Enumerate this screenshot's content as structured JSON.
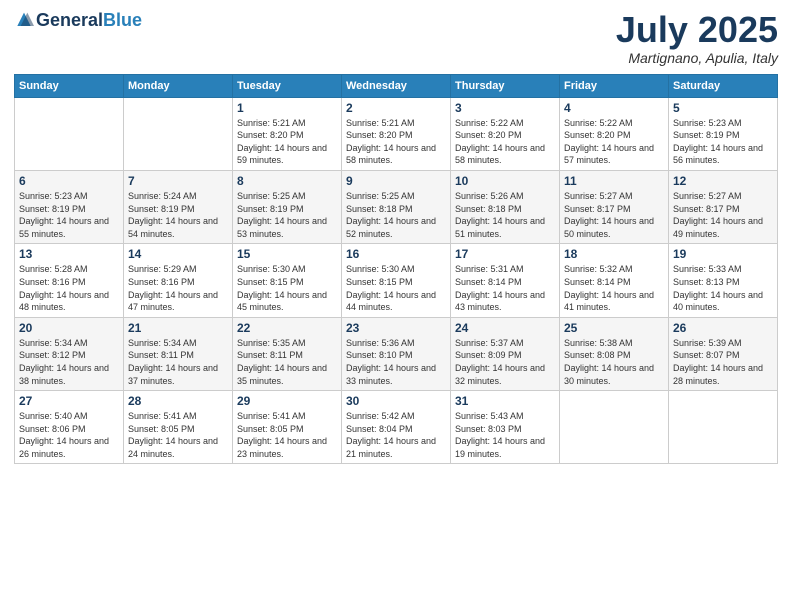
{
  "header": {
    "logo": {
      "text_general": "General",
      "text_blue": "Blue"
    },
    "month_title": "July 2025",
    "location": "Martignano, Apulia, Italy"
  },
  "weekdays": [
    "Sunday",
    "Monday",
    "Tuesday",
    "Wednesday",
    "Thursday",
    "Friday",
    "Saturday"
  ],
  "weeks": [
    [
      {
        "day": "",
        "sunrise": "",
        "sunset": "",
        "daylight": ""
      },
      {
        "day": "",
        "sunrise": "",
        "sunset": "",
        "daylight": ""
      },
      {
        "day": "1",
        "sunrise": "Sunrise: 5:21 AM",
        "sunset": "Sunset: 8:20 PM",
        "daylight": "Daylight: 14 hours and 59 minutes."
      },
      {
        "day": "2",
        "sunrise": "Sunrise: 5:21 AM",
        "sunset": "Sunset: 8:20 PM",
        "daylight": "Daylight: 14 hours and 58 minutes."
      },
      {
        "day": "3",
        "sunrise": "Sunrise: 5:22 AM",
        "sunset": "Sunset: 8:20 PM",
        "daylight": "Daylight: 14 hours and 58 minutes."
      },
      {
        "day": "4",
        "sunrise": "Sunrise: 5:22 AM",
        "sunset": "Sunset: 8:20 PM",
        "daylight": "Daylight: 14 hours and 57 minutes."
      },
      {
        "day": "5",
        "sunrise": "Sunrise: 5:23 AM",
        "sunset": "Sunset: 8:19 PM",
        "daylight": "Daylight: 14 hours and 56 minutes."
      }
    ],
    [
      {
        "day": "6",
        "sunrise": "Sunrise: 5:23 AM",
        "sunset": "Sunset: 8:19 PM",
        "daylight": "Daylight: 14 hours and 55 minutes."
      },
      {
        "day": "7",
        "sunrise": "Sunrise: 5:24 AM",
        "sunset": "Sunset: 8:19 PM",
        "daylight": "Daylight: 14 hours and 54 minutes."
      },
      {
        "day": "8",
        "sunrise": "Sunrise: 5:25 AM",
        "sunset": "Sunset: 8:19 PM",
        "daylight": "Daylight: 14 hours and 53 minutes."
      },
      {
        "day": "9",
        "sunrise": "Sunrise: 5:25 AM",
        "sunset": "Sunset: 8:18 PM",
        "daylight": "Daylight: 14 hours and 52 minutes."
      },
      {
        "day": "10",
        "sunrise": "Sunrise: 5:26 AM",
        "sunset": "Sunset: 8:18 PM",
        "daylight": "Daylight: 14 hours and 51 minutes."
      },
      {
        "day": "11",
        "sunrise": "Sunrise: 5:27 AM",
        "sunset": "Sunset: 8:17 PM",
        "daylight": "Daylight: 14 hours and 50 minutes."
      },
      {
        "day": "12",
        "sunrise": "Sunrise: 5:27 AM",
        "sunset": "Sunset: 8:17 PM",
        "daylight": "Daylight: 14 hours and 49 minutes."
      }
    ],
    [
      {
        "day": "13",
        "sunrise": "Sunrise: 5:28 AM",
        "sunset": "Sunset: 8:16 PM",
        "daylight": "Daylight: 14 hours and 48 minutes."
      },
      {
        "day": "14",
        "sunrise": "Sunrise: 5:29 AM",
        "sunset": "Sunset: 8:16 PM",
        "daylight": "Daylight: 14 hours and 47 minutes."
      },
      {
        "day": "15",
        "sunrise": "Sunrise: 5:30 AM",
        "sunset": "Sunset: 8:15 PM",
        "daylight": "Daylight: 14 hours and 45 minutes."
      },
      {
        "day": "16",
        "sunrise": "Sunrise: 5:30 AM",
        "sunset": "Sunset: 8:15 PM",
        "daylight": "Daylight: 14 hours and 44 minutes."
      },
      {
        "day": "17",
        "sunrise": "Sunrise: 5:31 AM",
        "sunset": "Sunset: 8:14 PM",
        "daylight": "Daylight: 14 hours and 43 minutes."
      },
      {
        "day": "18",
        "sunrise": "Sunrise: 5:32 AM",
        "sunset": "Sunset: 8:14 PM",
        "daylight": "Daylight: 14 hours and 41 minutes."
      },
      {
        "day": "19",
        "sunrise": "Sunrise: 5:33 AM",
        "sunset": "Sunset: 8:13 PM",
        "daylight": "Daylight: 14 hours and 40 minutes."
      }
    ],
    [
      {
        "day": "20",
        "sunrise": "Sunrise: 5:34 AM",
        "sunset": "Sunset: 8:12 PM",
        "daylight": "Daylight: 14 hours and 38 minutes."
      },
      {
        "day": "21",
        "sunrise": "Sunrise: 5:34 AM",
        "sunset": "Sunset: 8:11 PM",
        "daylight": "Daylight: 14 hours and 37 minutes."
      },
      {
        "day": "22",
        "sunrise": "Sunrise: 5:35 AM",
        "sunset": "Sunset: 8:11 PM",
        "daylight": "Daylight: 14 hours and 35 minutes."
      },
      {
        "day": "23",
        "sunrise": "Sunrise: 5:36 AM",
        "sunset": "Sunset: 8:10 PM",
        "daylight": "Daylight: 14 hours and 33 minutes."
      },
      {
        "day": "24",
        "sunrise": "Sunrise: 5:37 AM",
        "sunset": "Sunset: 8:09 PM",
        "daylight": "Daylight: 14 hours and 32 minutes."
      },
      {
        "day": "25",
        "sunrise": "Sunrise: 5:38 AM",
        "sunset": "Sunset: 8:08 PM",
        "daylight": "Daylight: 14 hours and 30 minutes."
      },
      {
        "day": "26",
        "sunrise": "Sunrise: 5:39 AM",
        "sunset": "Sunset: 8:07 PM",
        "daylight": "Daylight: 14 hours and 28 minutes."
      }
    ],
    [
      {
        "day": "27",
        "sunrise": "Sunrise: 5:40 AM",
        "sunset": "Sunset: 8:06 PM",
        "daylight": "Daylight: 14 hours and 26 minutes."
      },
      {
        "day": "28",
        "sunrise": "Sunrise: 5:41 AM",
        "sunset": "Sunset: 8:05 PM",
        "daylight": "Daylight: 14 hours and 24 minutes."
      },
      {
        "day": "29",
        "sunrise": "Sunrise: 5:41 AM",
        "sunset": "Sunset: 8:05 PM",
        "daylight": "Daylight: 14 hours and 23 minutes."
      },
      {
        "day": "30",
        "sunrise": "Sunrise: 5:42 AM",
        "sunset": "Sunset: 8:04 PM",
        "daylight": "Daylight: 14 hours and 21 minutes."
      },
      {
        "day": "31",
        "sunrise": "Sunrise: 5:43 AM",
        "sunset": "Sunset: 8:03 PM",
        "daylight": "Daylight: 14 hours and 19 minutes."
      },
      {
        "day": "",
        "sunrise": "",
        "sunset": "",
        "daylight": ""
      },
      {
        "day": "",
        "sunrise": "",
        "sunset": "",
        "daylight": ""
      }
    ]
  ]
}
